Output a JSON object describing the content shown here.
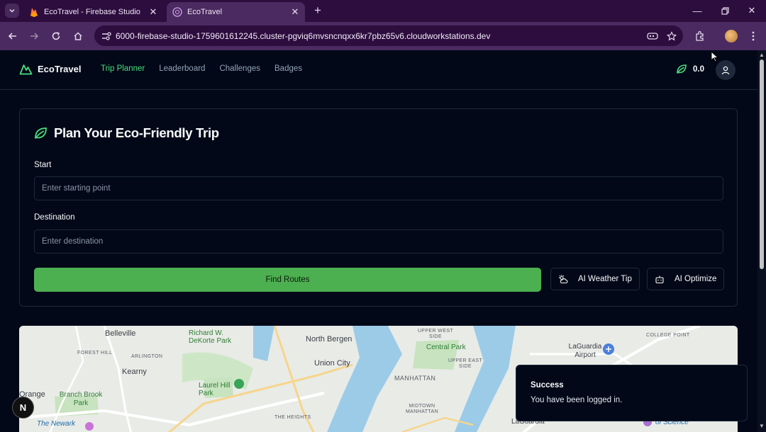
{
  "browser": {
    "tabs": [
      {
        "title": "EcoTravel - Firebase Studio",
        "active": false
      },
      {
        "title": "EcoTravel",
        "active": true
      }
    ],
    "url": "6000-firebase-studio-1759601612245.cluster-pgviq6mvsncnqxx6kr7pbz65v6.cloudworkstations.dev",
    "colors": {
      "frame": "#2c0d3e",
      "toolbar": "#4a2a60"
    }
  },
  "nav": {
    "brand": "EcoTravel",
    "links": [
      "Trip Planner",
      "Leaderboard",
      "Challenges",
      "Badges"
    ],
    "active_link": "Trip Planner",
    "points": "0.0"
  },
  "planner": {
    "title": "Plan Your Eco-Friendly Trip",
    "start_label": "Start",
    "start_placeholder": "Enter starting point",
    "destination_label": "Destination",
    "destination_placeholder": "Enter destination",
    "find_routes": "Find Routes",
    "weather_tip": "AI Weather Tip",
    "optimize": "AI Optimize"
  },
  "map": {
    "labels": [
      "Belleville",
      "Richard W. DeKorte Park",
      "North Bergen",
      "UPPER WEST SIDE",
      "Central Park",
      "COLLEGE POINT",
      "LaGuardia Airport",
      "FOREST HILL",
      "ARLINGTON",
      "Kearny",
      "Union City",
      "UPPER EAST SIDE",
      "MANHATTAN",
      "Laurel Hill Park",
      "Orange",
      "Branch Brook Park",
      "MIDTOWN MANHATTAN",
      "THE HEIGHTS",
      "The Newark",
      "LaGuardia",
      "of Science"
    ]
  },
  "toast": {
    "title": "Success",
    "message": "You have been logged in."
  },
  "dev_badge": "N",
  "accent": "#4caf50"
}
